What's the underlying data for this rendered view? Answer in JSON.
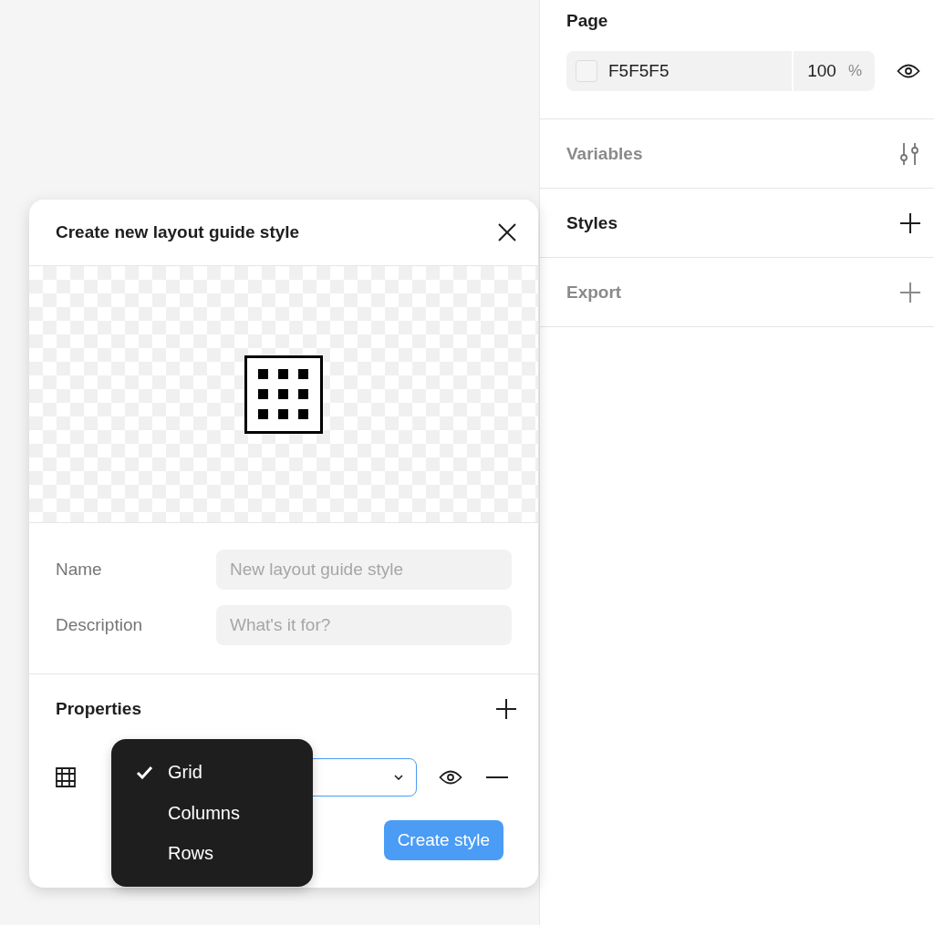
{
  "dialog": {
    "title": "Create new layout guide style",
    "fields": [
      {
        "label": "Name",
        "placeholder": "New layout guide style"
      },
      {
        "label": "Description",
        "placeholder": "What's it for?"
      }
    ],
    "properties": {
      "title": "Properties",
      "guide": {
        "visible": true
      },
      "menu": [
        {
          "label": "Grid",
          "selected": true
        },
        {
          "label": "Columns",
          "selected": false
        },
        {
          "label": "Rows",
          "selected": false
        }
      ]
    },
    "button": "Create style"
  },
  "panel": {
    "page": {
      "title": "Page",
      "color": "F5F5F5",
      "opacity": "100",
      "unit": "%",
      "visible": true
    },
    "sections": [
      {
        "title": "Variables",
        "kind": "variables",
        "muted": true
      },
      {
        "title": "Styles",
        "kind": "add",
        "muted": false
      },
      {
        "title": "Export",
        "kind": "add",
        "muted": true
      }
    ]
  }
}
